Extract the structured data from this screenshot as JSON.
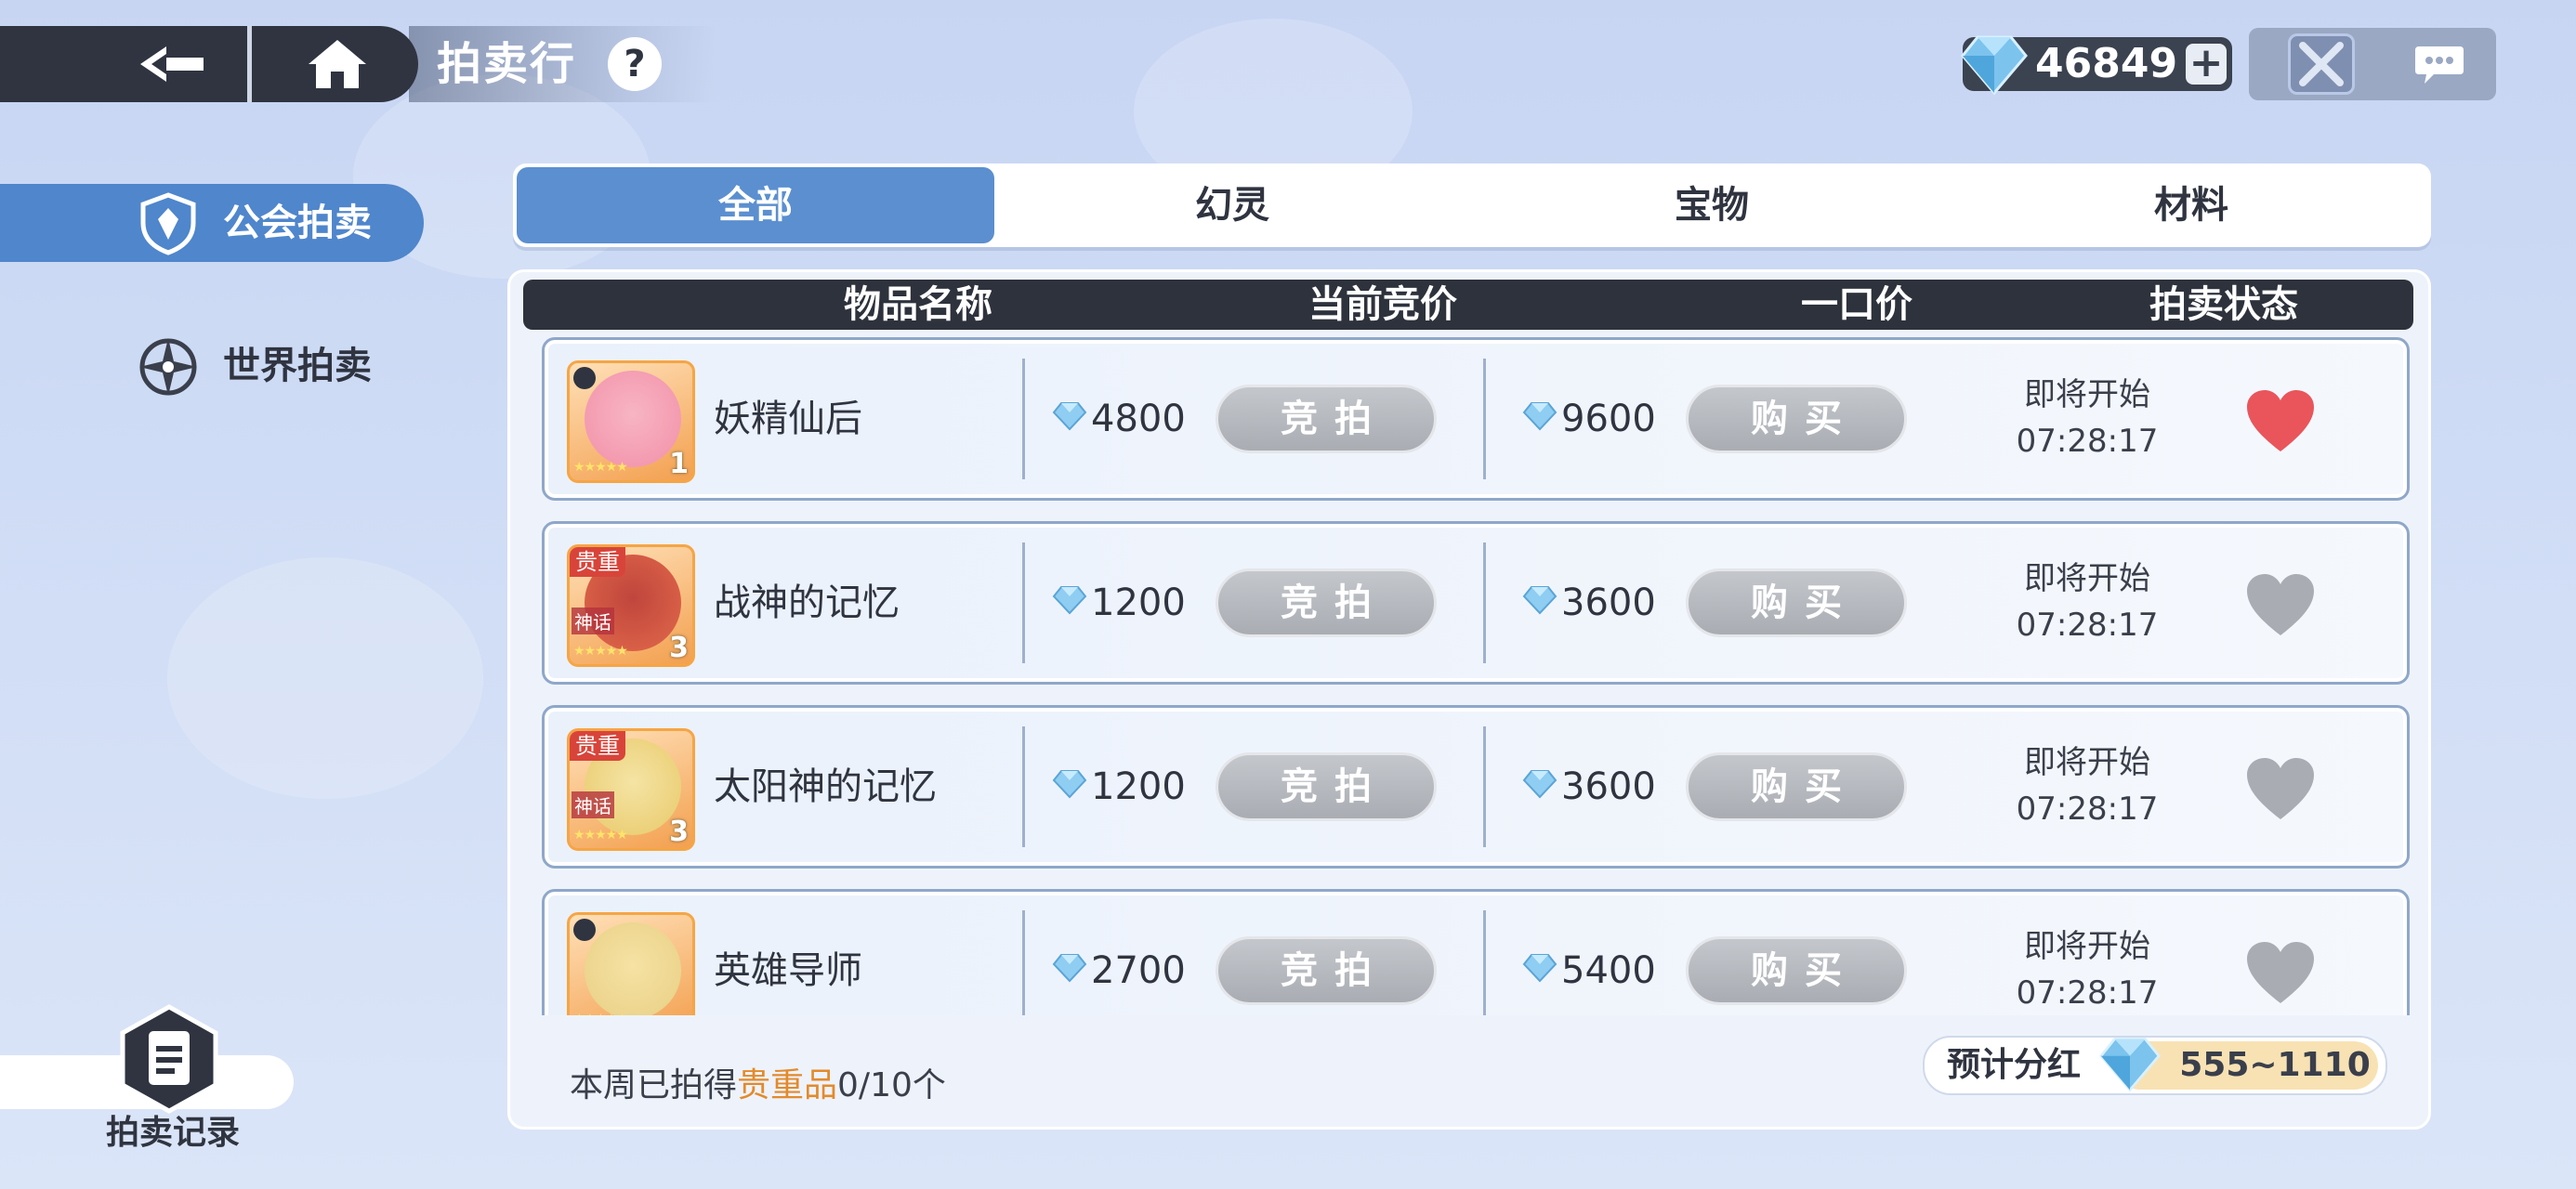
{
  "header": {
    "title": "拍卖行",
    "help_label": "?",
    "currency_value": "46849",
    "plus_label": "+"
  },
  "sidebar": {
    "tabs": [
      {
        "label": "公会拍卖",
        "icon": "shield-icon",
        "active": true
      },
      {
        "label": "世界拍卖",
        "icon": "compass-icon",
        "active": false
      }
    ],
    "record_label": "拍卖记录"
  },
  "category_tabs": [
    {
      "label": "全部",
      "active": true
    },
    {
      "label": "幻灵",
      "active": false
    },
    {
      "label": "宝物",
      "active": false
    },
    {
      "label": "材料",
      "active": false
    }
  ],
  "table": {
    "headers": [
      "物品名称",
      "当前竞价",
      "一口价",
      "拍卖状态"
    ],
    "bid_label": "竞拍",
    "buy_label": "购买",
    "rows": [
      {
        "name": "妖精仙后",
        "bid": "4800",
        "buyout": "9600",
        "status": "即将开始",
        "time": "07:28:17",
        "qty": "1",
        "favorited": true,
        "badge": "",
        "myth": "",
        "colors": [
          "#f7b5c3",
          "#f38fa8"
        ]
      },
      {
        "name": "战神的记忆",
        "bid": "1200",
        "buyout": "3600",
        "status": "即将开始",
        "time": "07:28:17",
        "qty": "3",
        "favorited": false,
        "badge": "贵重",
        "myth": "神话",
        "colors": [
          "#c0453d",
          "#e26a4a"
        ]
      },
      {
        "name": "太阳神的记忆",
        "bid": "1200",
        "buyout": "3600",
        "status": "即将开始",
        "time": "07:28:17",
        "qty": "3",
        "favorited": false,
        "badge": "贵重",
        "myth": "神话",
        "colors": [
          "#f4e4a4",
          "#e9c96a"
        ]
      },
      {
        "name": "英雄导师",
        "bid": "2700",
        "buyout": "5400",
        "status": "即将开始",
        "time": "07:28:17",
        "qty": "",
        "favorited": false,
        "badge": "",
        "myth": "",
        "colors": [
          "#f6e2a4",
          "#e8cf84"
        ]
      }
    ]
  },
  "footer": {
    "weekly_prefix": "本周已拍得",
    "weekly_highlight": "贵重品",
    "weekly_suffix": "0/10个",
    "dividend_label": "预计分红",
    "dividend_range": "555~1110"
  },
  "colors": {
    "accent": "#5b8fd0",
    "favorite_active": "#e9555b",
    "favorite_inactive": "#a9adb3",
    "highlight": "#e38a2c"
  }
}
